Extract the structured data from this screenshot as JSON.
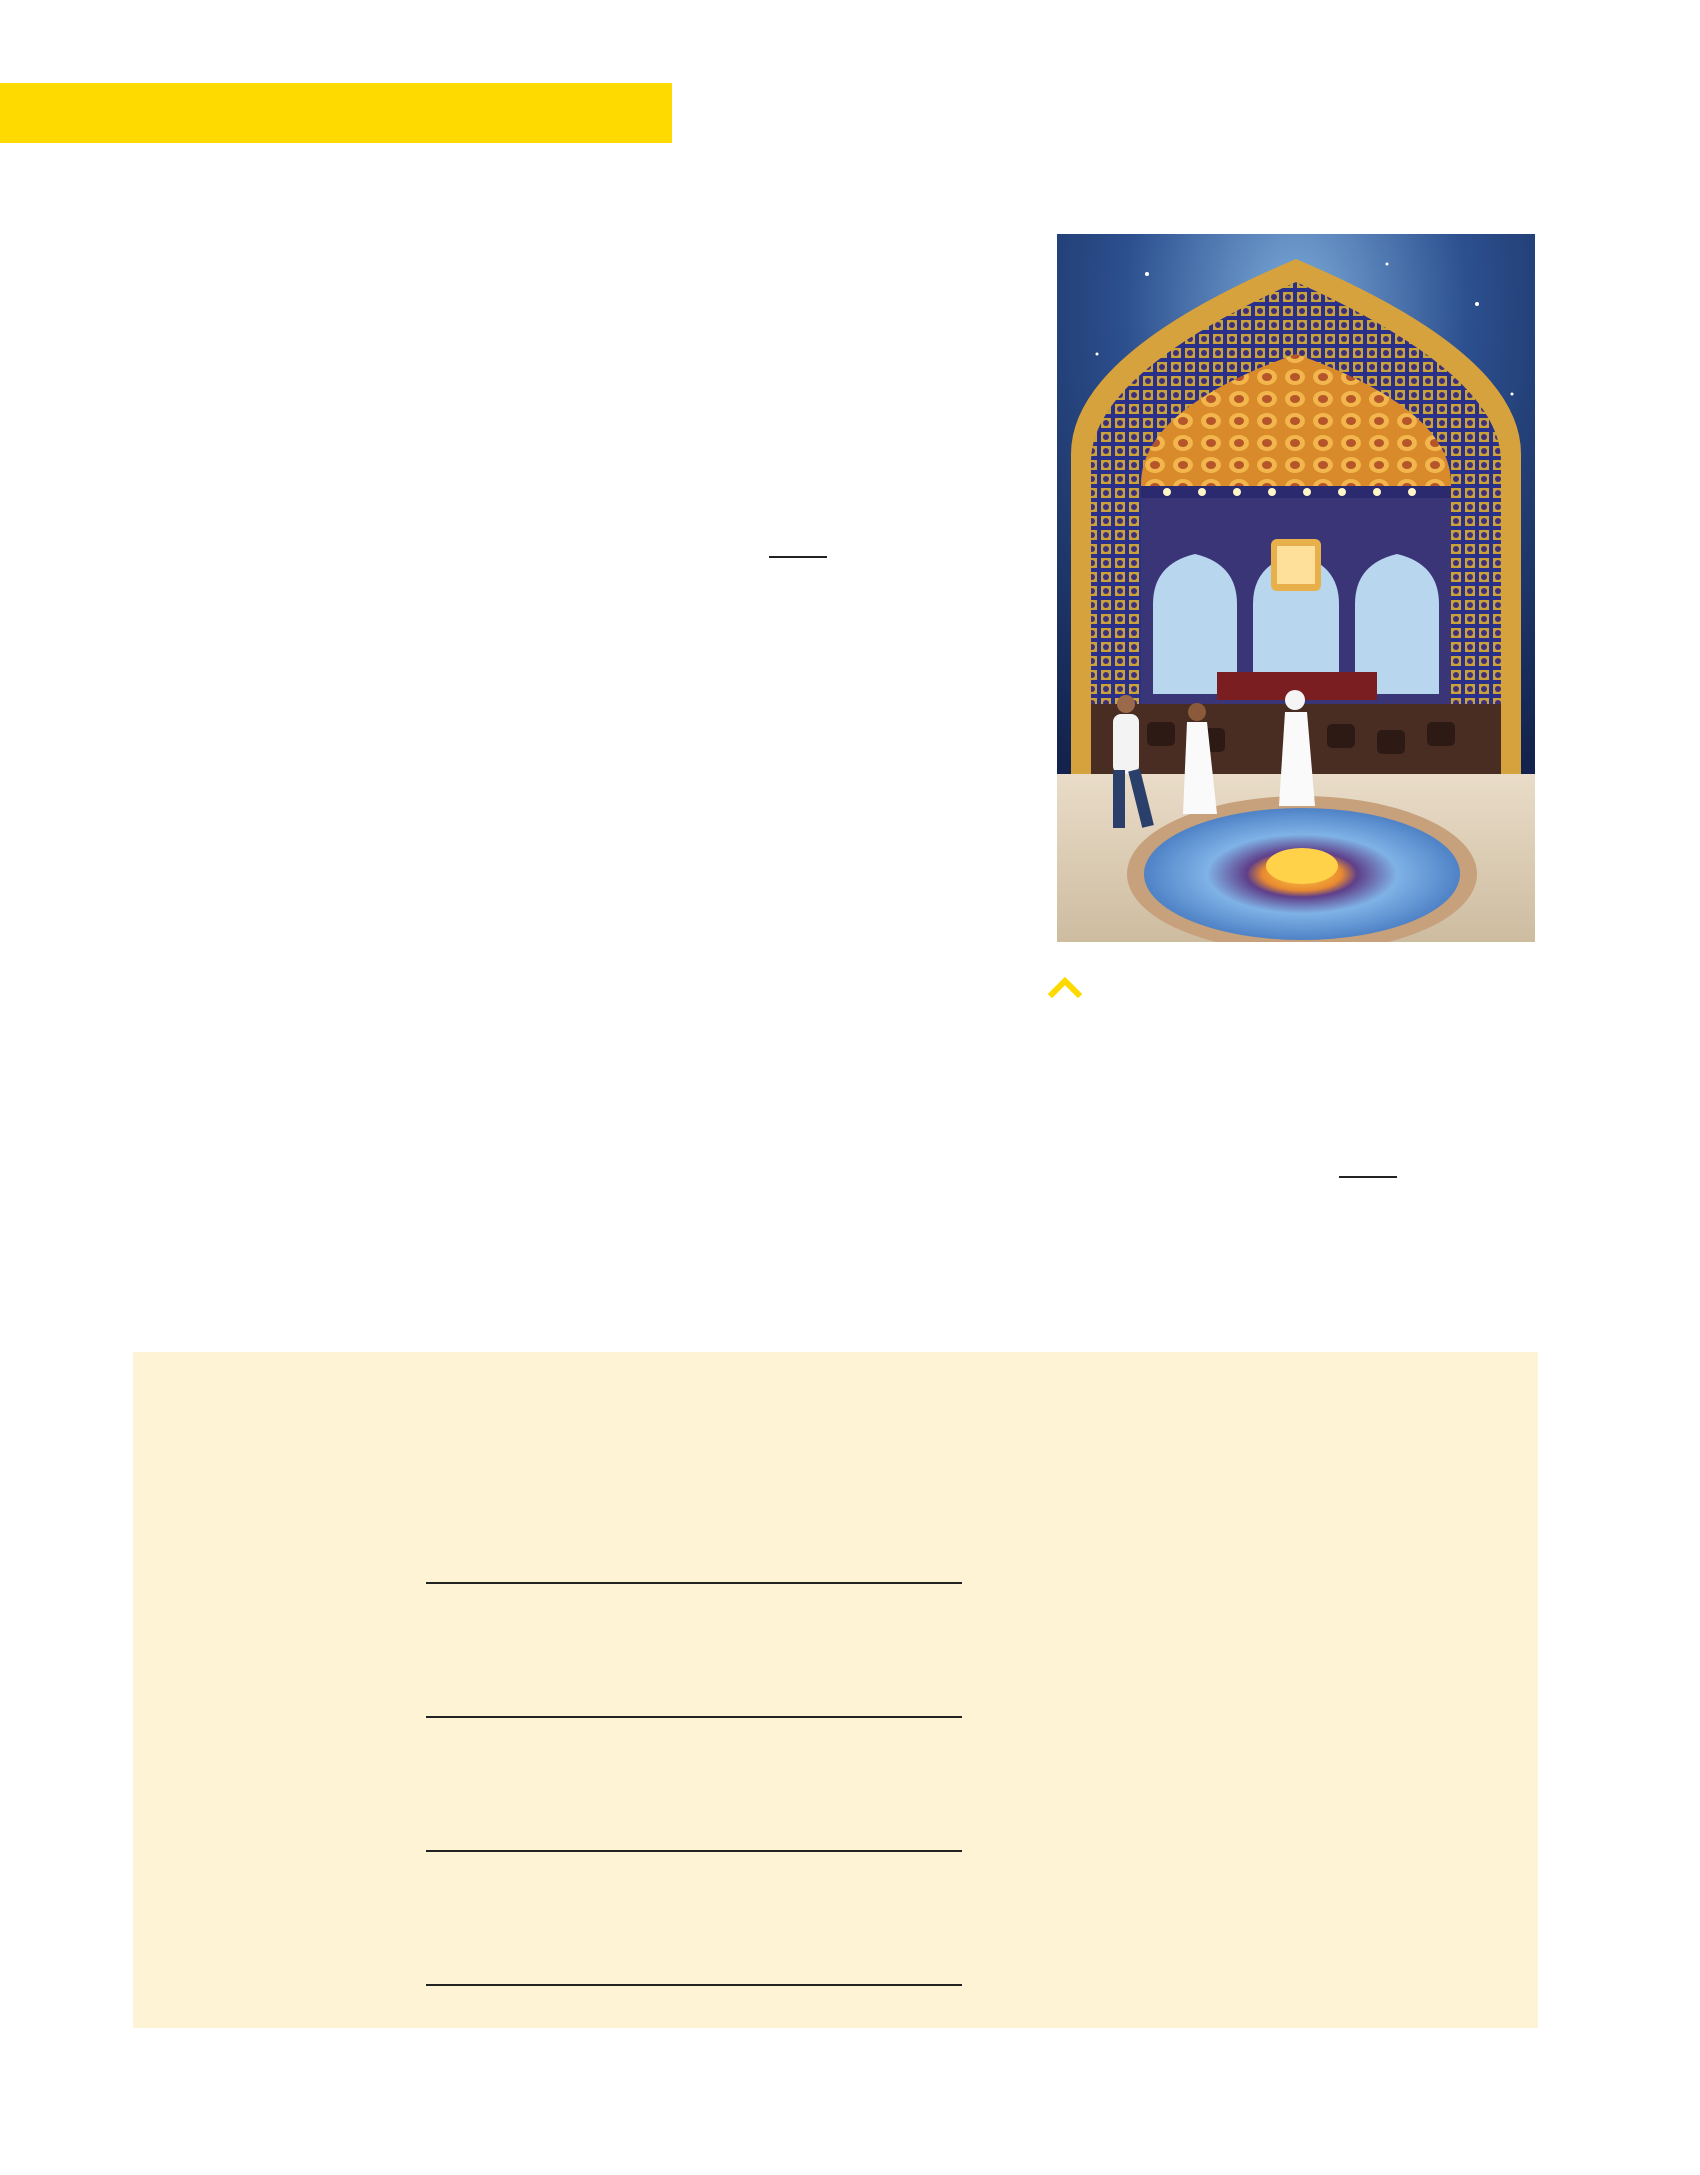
{
  "colors": {
    "header_bar": "#FFDA00",
    "chevron": "#FFDA00",
    "exercise_background": "#FEF3D4",
    "rule": "#222222"
  },
  "header": {
    "bar": "yellow-section-header-bar"
  },
  "photo": {
    "subject": "ornate-tiled-arch-interior-with-cafe",
    "caption_icon": "chevron-up-icon"
  },
  "exercise": {
    "answer_lines": [
      {
        "id": 1
      },
      {
        "id": 2
      },
      {
        "id": 3
      },
      {
        "id": 4
      }
    ]
  }
}
